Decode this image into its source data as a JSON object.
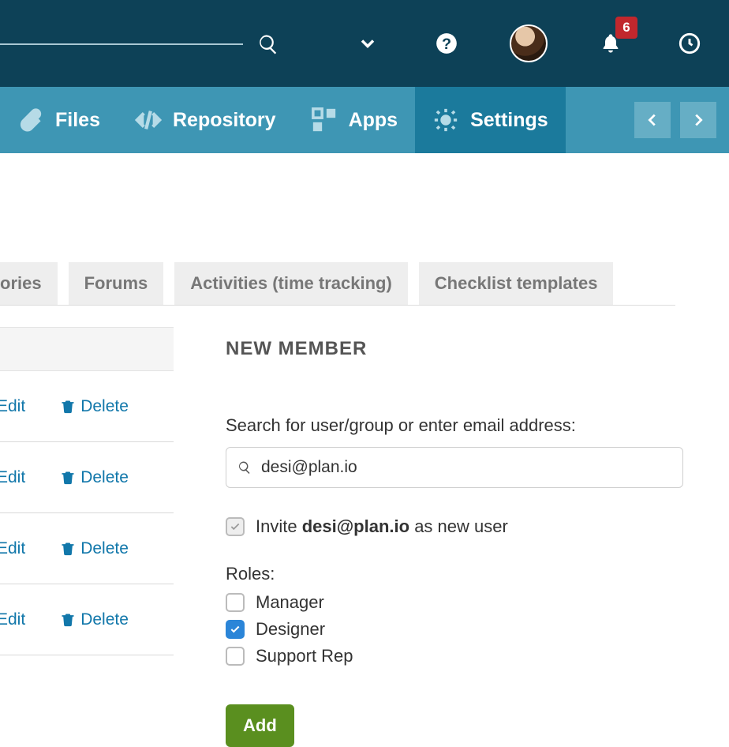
{
  "topbar": {
    "notification_count": "6"
  },
  "nav": {
    "items": [
      {
        "label": "Files"
      },
      {
        "label": "Repository"
      },
      {
        "label": "Apps"
      },
      {
        "label": "Settings"
      }
    ]
  },
  "subtabs": {
    "items": [
      {
        "label": "ories"
      },
      {
        "label": "Forums"
      },
      {
        "label": "Activities (time tracking)"
      },
      {
        "label": "Checklist templates"
      }
    ]
  },
  "actions": {
    "edit": "Edit",
    "delete": "Delete"
  },
  "panel": {
    "title": "NEW MEMBER",
    "search_label": "Search for user/group or enter email address:",
    "search_value": "desi@plan.io",
    "invite_prefix": "Invite ",
    "invite_email": "desi@plan.io",
    "invite_suffix": " as new user",
    "roles_label": "Roles:",
    "roles": [
      {
        "label": "Manager",
        "checked": false
      },
      {
        "label": "Designer",
        "checked": true
      },
      {
        "label": "Support Rep",
        "checked": false
      }
    ],
    "add_label": "Add"
  }
}
